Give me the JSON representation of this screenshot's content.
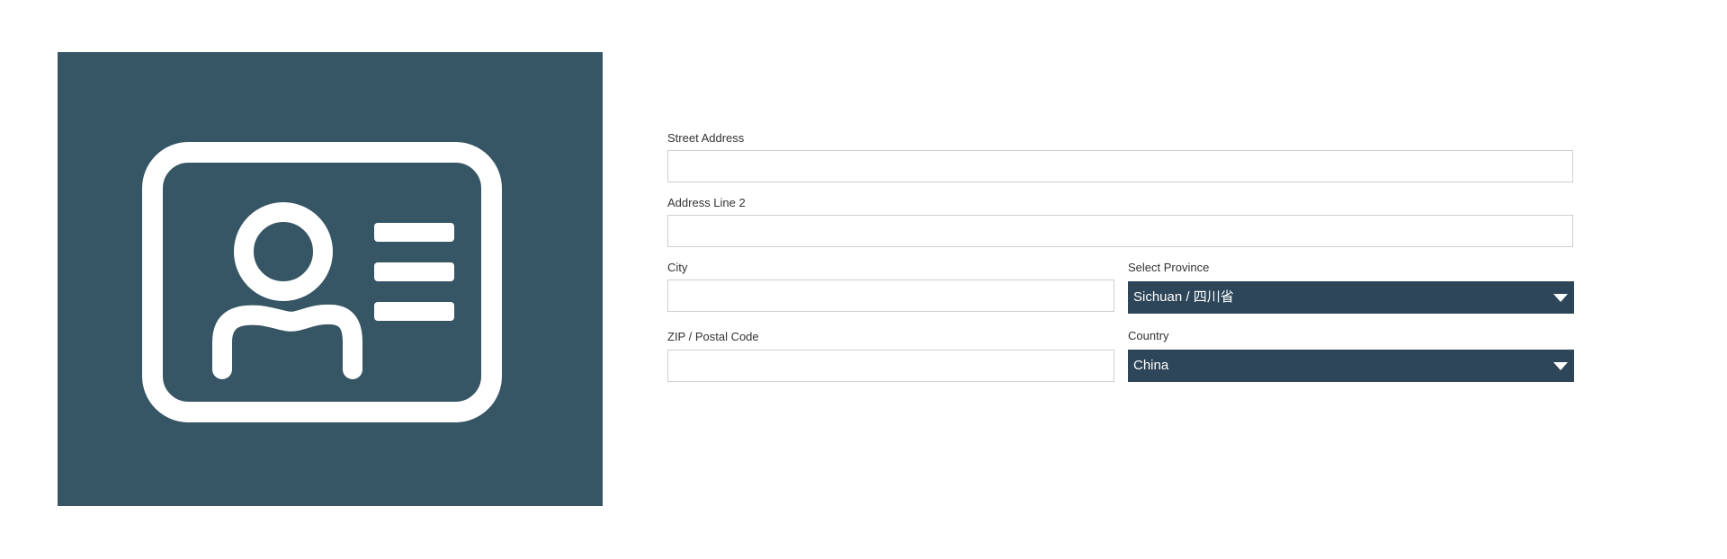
{
  "colors": {
    "hero_background": "#365565",
    "select_background": "#2e4659",
    "input_border": "#cfcfcf",
    "label_text": "#333333"
  },
  "hero": {
    "icon": "id-card-icon"
  },
  "form": {
    "street_address": {
      "label": "Street Address",
      "value": ""
    },
    "address_line_2": {
      "label": "Address Line 2",
      "value": ""
    },
    "city": {
      "label": "City",
      "value": ""
    },
    "province": {
      "label": "Select Province",
      "selected": "Sichuan / 四川省"
    },
    "zip": {
      "label": "ZIP / Postal Code",
      "value": ""
    },
    "country": {
      "label": "Country",
      "selected": "China"
    }
  }
}
